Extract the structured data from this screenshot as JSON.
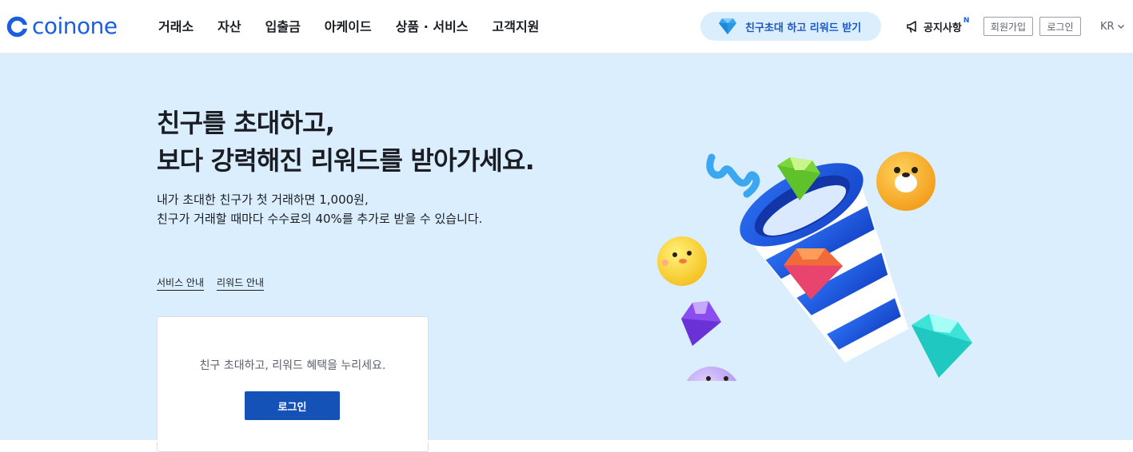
{
  "brand": {
    "name": "coinone",
    "color": "#1a5fe0"
  },
  "nav": {
    "items": [
      {
        "label": "거래소"
      },
      {
        "label": "자산"
      },
      {
        "label": "입출금"
      },
      {
        "label": "아케이드"
      },
      {
        "label": "상품 · 서비스"
      },
      {
        "label": "고객지원"
      }
    ]
  },
  "header": {
    "invite_label": "친구초대 하고 리워드 받기",
    "notice_label": "공지사항",
    "notice_badge": "N",
    "signup_label": "회원가입",
    "login_label": "로그인",
    "language": "KR"
  },
  "hero": {
    "title_line1": "친구를 초대하고,",
    "title_line2": "보다 강력해진 리워드를 받아가세요.",
    "sub_line1": "내가 초대한 친구가 첫 거래하면 1,000원,",
    "sub_line2": "친구가 거래할 때마다 수수료의 40%를 추가로 받을 수 있습니다.",
    "link_service": "서비스 안내",
    "link_reward": "리워드 안내"
  },
  "login_card": {
    "message": "친구 초대하고, 리워드 혜택을 누리세요.",
    "button_label": "로그인"
  },
  "colors": {
    "hero_bg": "#dbeefd",
    "primary_button": "#1552b8",
    "accent": "#1a5fe0"
  },
  "icons": {
    "invite": "diamond-icon",
    "notice": "megaphone-icon",
    "language": "chevron-down-icon"
  }
}
